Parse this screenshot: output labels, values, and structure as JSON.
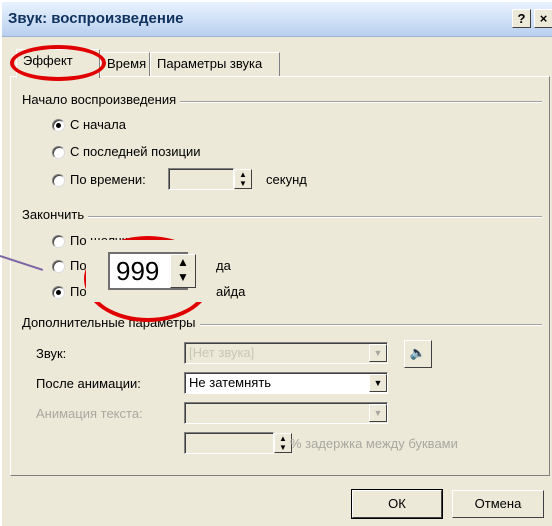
{
  "window": {
    "title": "Звук: воспроизведение",
    "help_label": "?",
    "close_label": "×"
  },
  "tabs": [
    {
      "label": "Эффект"
    },
    {
      "label": "Время"
    },
    {
      "label": "Параметры звука"
    }
  ],
  "start_group": {
    "title": "Начало воспроизведения",
    "opt1": "С начала",
    "opt2": "С последней позиции",
    "opt3": "По времени:",
    "seconds_unit": "секунд"
  },
  "end_group": {
    "title": "Закончить",
    "opt1": "По щелчку",
    "opt2_start": "После",
    "opt2_end": "да",
    "opt3_start": "По",
    "opt3_end": "айда",
    "slides_value": "999"
  },
  "extra_group": {
    "title": "Дополнительные параметры",
    "sound_label": "Звук:",
    "sound_value": "[Нет звука]",
    "after_anim_label": "После анимации:",
    "after_anim_value": "Не затемнять",
    "text_anim_label": "Анимация текста:",
    "delay_label": "% задержка между буквами"
  },
  "buttons": {
    "ok": "ОК",
    "cancel": "Отмена"
  },
  "colors": {
    "highlight_circle": "#e00000",
    "titlebar": "#cfe0f6",
    "background": "#e8aee6"
  }
}
